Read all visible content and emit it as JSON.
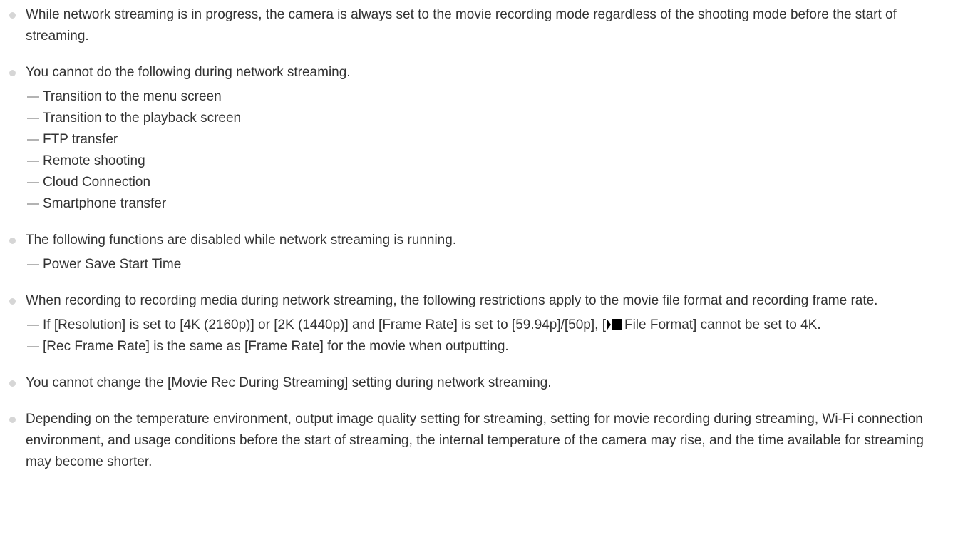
{
  "notes": [
    {
      "text": "While network streaming is in progress, the camera is always set to the movie recording mode regardless of the shooting mode before the start of streaming.",
      "sub": []
    },
    {
      "text": "You cannot do the following during network streaming.",
      "sub": [
        "Transition to the menu screen",
        "Transition to the playback screen",
        "FTP transfer",
        "Remote shooting",
        "Cloud Connection",
        "Smartphone transfer"
      ]
    },
    {
      "text": "The following functions are disabled while network streaming is running.",
      "sub": [
        "Power Save Start Time"
      ]
    },
    {
      "text": "When recording to recording media during network streaming, the following restrictions apply to the movie file format and recording frame rate.",
      "sub_file_format": {
        "before": "If [Resolution] is set to [4K (2160p)] or [2K (1440p)] and [Frame Rate] is set to [59.94p]/[50p], [",
        "icon": "movie-icon",
        "after": "File Format] cannot be set to 4K."
      },
      "sub": [
        "[Rec Frame Rate] is the same as [Frame Rate] for the movie when outputting."
      ]
    },
    {
      "text": "You cannot change the [Movie Rec During Streaming] setting during network streaming.",
      "sub": []
    },
    {
      "text": "Depending on the temperature environment, output image quality setting for streaming, setting for movie recording during streaming, Wi-Fi connection environment, and usage conditions before the start of streaming, the internal temperature of the camera may rise, and the time available for streaming may become shorter.",
      "sub": []
    }
  ]
}
